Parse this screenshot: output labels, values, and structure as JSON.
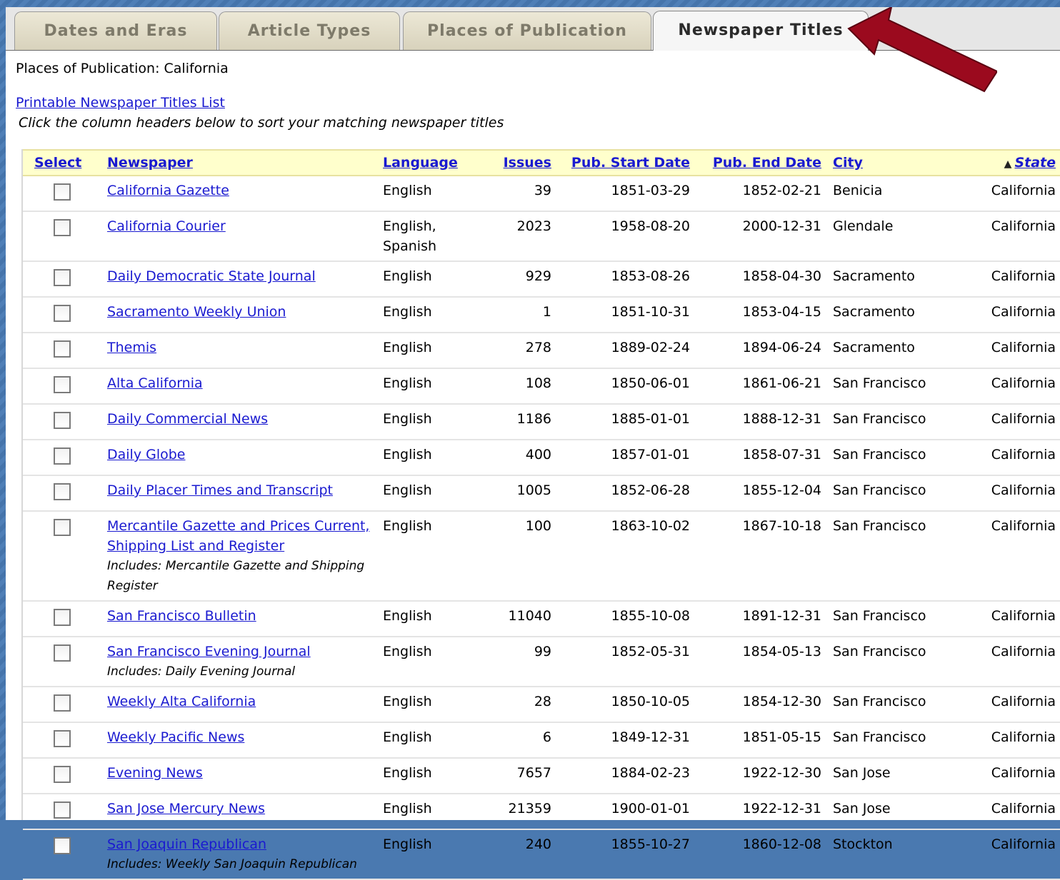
{
  "tabs": [
    {
      "label": "Dates and Eras",
      "active": false
    },
    {
      "label": "Article Types",
      "active": false
    },
    {
      "label": "Places of Publication",
      "active": false
    },
    {
      "label": "Newspaper Titles",
      "active": true
    }
  ],
  "breadcrumb": "Places of Publication: California",
  "print_link": "Printable Newspaper Titles List",
  "hint": "Click the column headers below to sort your matching newspaper titles",
  "columns": {
    "select": "Select",
    "newspaper": "Newspaper",
    "language": "Language",
    "issues": "Issues",
    "start": "Pub. Start Date",
    "end": "Pub. End Date",
    "city": "City",
    "state": "State",
    "state_sort_indicator": "▲"
  },
  "rows": [
    {
      "title": "California Gazette",
      "includes": "",
      "language": "English",
      "issues": "39",
      "start": "1851-03-29",
      "end": "1852-02-21",
      "city": "Benicia",
      "state": "California"
    },
    {
      "title": "California Courier",
      "includes": "",
      "language": "English, Spanish",
      "issues": "2023",
      "start": "1958-08-20",
      "end": "2000-12-31",
      "city": "Glendale",
      "state": "California"
    },
    {
      "title": "Daily Democratic State Journal",
      "includes": "",
      "language": "English",
      "issues": "929",
      "start": "1853-08-26",
      "end": "1858-04-30",
      "city": "Sacramento",
      "state": "California"
    },
    {
      "title": "Sacramento Weekly Union",
      "includes": "",
      "language": "English",
      "issues": "1",
      "start": "1851-10-31",
      "end": "1853-04-15",
      "city": "Sacramento",
      "state": "California"
    },
    {
      "title": "Themis",
      "includes": "",
      "language": "English",
      "issues": "278",
      "start": "1889-02-24",
      "end": "1894-06-24",
      "city": "Sacramento",
      "state": "California"
    },
    {
      "title": "Alta California",
      "includes": "",
      "language": "English",
      "issues": "108",
      "start": "1850-06-01",
      "end": "1861-06-21",
      "city": "San Francisco",
      "state": "California"
    },
    {
      "title": "Daily Commercial News",
      "includes": "",
      "language": "English",
      "issues": "1186",
      "start": "1885-01-01",
      "end": "1888-12-31",
      "city": "San Francisco",
      "state": "California"
    },
    {
      "title": "Daily Globe",
      "includes": "",
      "language": "English",
      "issues": "400",
      "start": "1857-01-01",
      "end": "1858-07-31",
      "city": "San Francisco",
      "state": "California"
    },
    {
      "title": "Daily Placer Times and Transcript",
      "includes": "",
      "language": "English",
      "issues": "1005",
      "start": "1852-06-28",
      "end": "1855-12-04",
      "city": "San Francisco",
      "state": "California"
    },
    {
      "title": "Mercantile Gazette and Prices Current, Shipping List and Register",
      "includes": "Includes: Mercantile Gazette and Shipping Register",
      "language": "English",
      "issues": "100",
      "start": "1863-10-02",
      "end": "1867-10-18",
      "city": "San Francisco",
      "state": "California"
    },
    {
      "title": "San Francisco Bulletin",
      "includes": "",
      "language": "English",
      "issues": "11040",
      "start": "1855-10-08",
      "end": "1891-12-31",
      "city": "San Francisco",
      "state": "California"
    },
    {
      "title": "San Francisco Evening Journal",
      "includes": "Includes: Daily Evening Journal",
      "language": "English",
      "issues": "99",
      "start": "1852-05-31",
      "end": "1854-05-13",
      "city": "San Francisco",
      "state": "California"
    },
    {
      "title": "Weekly Alta California",
      "includes": "",
      "language": "English",
      "issues": "28",
      "start": "1850-10-05",
      "end": "1854-12-30",
      "city": "San Francisco",
      "state": "California"
    },
    {
      "title": "Weekly Pacific News",
      "includes": "",
      "language": "English",
      "issues": "6",
      "start": "1849-12-31",
      "end": "1851-05-15",
      "city": "San Francisco",
      "state": "California"
    },
    {
      "title": "Evening News",
      "includes": "",
      "language": "English",
      "issues": "7657",
      "start": "1884-02-23",
      "end": "1922-12-30",
      "city": "San Jose",
      "state": "California"
    },
    {
      "title": "San Jose Mercury News",
      "includes": "",
      "language": "English",
      "issues": "21359",
      "start": "1900-01-01",
      "end": "1922-12-31",
      "city": "San Jose",
      "state": "California"
    },
    {
      "title": "San Joaquin Republican",
      "includes": "Includes: Weekly San Joaquin Republican",
      "language": "English",
      "issues": "240",
      "start": "1855-10-27",
      "end": "1860-12-08",
      "city": "Stockton",
      "state": "California"
    }
  ],
  "colors": {
    "link": "#1a1ad0",
    "header_bg": "#ffffcc",
    "arrow": "#9b0a1e",
    "frame": "#4a79b0"
  },
  "arrow_icon": "arrow-pointer-icon"
}
